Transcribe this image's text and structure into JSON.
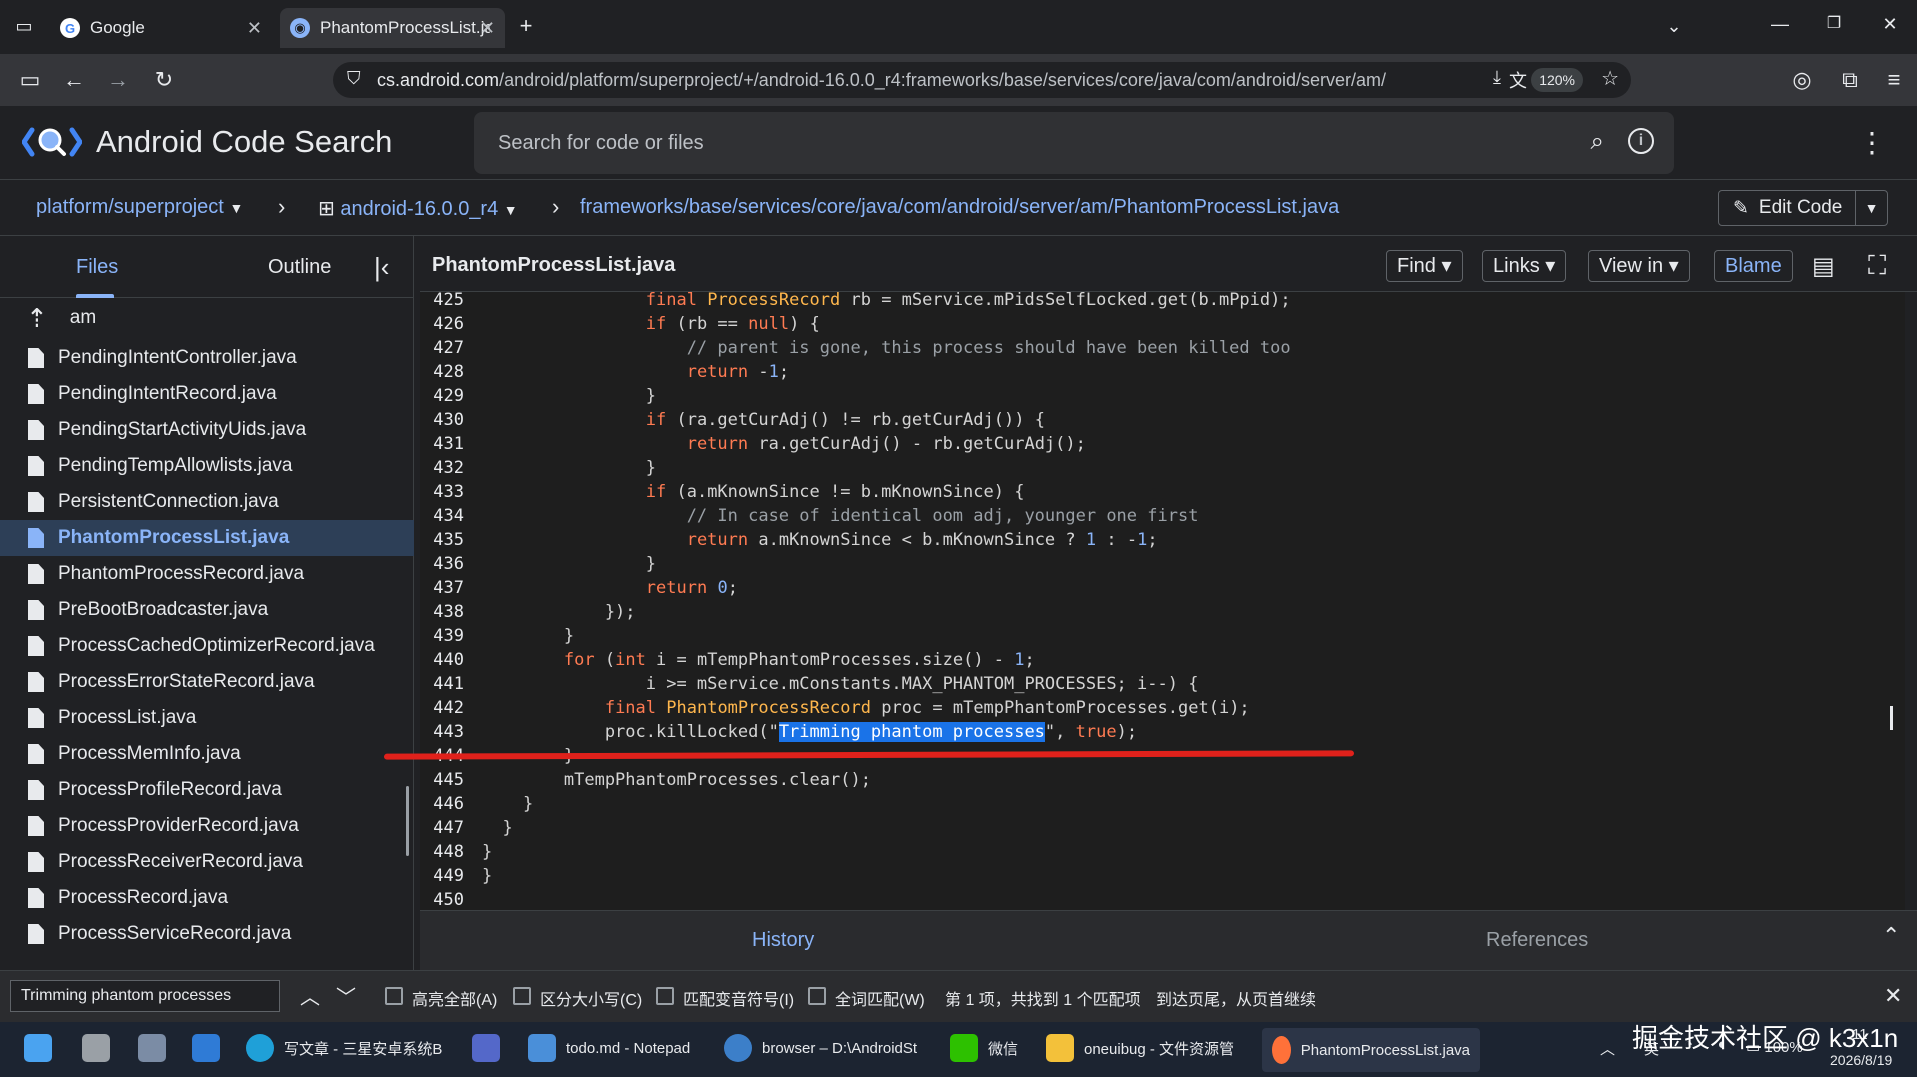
{
  "browser": {
    "tabs": [
      {
        "title": "Google"
      },
      {
        "title": "PhantomProcessList.java - Ar"
      }
    ],
    "url_host": "cs.android.com",
    "url_path": "/android/platform/superproject/+/android-16.0.0_r4:frameworks/base/services/core/java/com/android/server/am/",
    "zoom": "120%"
  },
  "app": {
    "title": "Android Code Search",
    "search_placeholder": "Search for code or files"
  },
  "breadcrumb": {
    "project": "platform/superproject",
    "branch": "android-16.0.0_r4",
    "path": "frameworks/base/services/core/java/com/android/server/am/PhantomProcessList.java",
    "edit_label": "Edit Code"
  },
  "sidebar": {
    "tab_files": "Files",
    "tab_outline": "Outline",
    "parent_dir": "am",
    "files": [
      "PendingIntentController.java",
      "PendingIntentRecord.java",
      "PendingStartActivityUids.java",
      "PendingTempAllowlists.java",
      "PersistentConnection.java",
      "PhantomProcessList.java",
      "PhantomProcessRecord.java",
      "PreBootBroadcaster.java",
      "ProcessCachedOptimizerRecord.java",
      "ProcessErrorStateRecord.java",
      "ProcessList.java",
      "ProcessMemInfo.java",
      "ProcessProfileRecord.java",
      "ProcessProviderRecord.java",
      "ProcessReceiverRecord.java",
      "ProcessRecord.java",
      "ProcessServiceRecord.java"
    ],
    "active_file": "PhantomProcessList.java"
  },
  "code": {
    "filename": "PhantomProcessList.java",
    "toolbar": {
      "find": "Find",
      "links": "Links",
      "view_in": "View in",
      "blame": "Blame"
    },
    "highlight": "Trimming phantom processes",
    "lines": [
      {
        "n": "425",
        "text": "                final ProcessRecord rb = mService.mPidsSelfLocked.get(b.mPpid);"
      },
      {
        "n": "426",
        "text": "                if (rb == null) {"
      },
      {
        "n": "427",
        "text": "                    // parent is gone, this process should have been killed too"
      },
      {
        "n": "428",
        "text": "                    return -1;"
      },
      {
        "n": "429",
        "text": "                }"
      },
      {
        "n": "430",
        "text": "                if (ra.getCurAdj() != rb.getCurAdj()) {"
      },
      {
        "n": "431",
        "text": "                    return ra.getCurAdj() - rb.getCurAdj();"
      },
      {
        "n": "432",
        "text": "                }"
      },
      {
        "n": "433",
        "text": "                if (a.mKnownSince != b.mKnownSince) {"
      },
      {
        "n": "434",
        "text": "                    // In case of identical oom adj, younger one first"
      },
      {
        "n": "435",
        "text": "                    return a.mKnownSince < b.mKnownSince ? 1 : -1;"
      },
      {
        "n": "436",
        "text": "                }"
      },
      {
        "n": "437",
        "text": "                return 0;"
      },
      {
        "n": "438",
        "text": "            });"
      },
      {
        "n": "439",
        "text": "        }"
      },
      {
        "n": "440",
        "text": "        for (int i = mTempPhantomProcesses.size() - 1;"
      },
      {
        "n": "441",
        "text": "                i >= mService.mConstants.MAX_PHANTOM_PROCESSES; i--) {"
      },
      {
        "n": "442",
        "text": "            final PhantomProcessRecord proc = mTempPhantomProcesses.get(i);"
      },
      {
        "n": "443",
        "text": "            proc.killLocked(\"Trimming phantom processes\", true);"
      },
      {
        "n": "444",
        "text": "        }"
      },
      {
        "n": "445",
        "text": "        mTempPhantomProcesses.clear();"
      },
      {
        "n": "446",
        "text": "    }"
      },
      {
        "n": "447",
        "text": "  }"
      },
      {
        "n": "448",
        "text": "}"
      },
      {
        "n": "449",
        "text": "}"
      },
      {
        "n": "450",
        "text": ""
      }
    ],
    "bottom_tabs": {
      "history": "History",
      "references": "References"
    }
  },
  "findbar": {
    "query": "Trimming phantom processes",
    "opt_highlight_all": "高亮全部(A)",
    "opt_match_case": "区分大小写(C)",
    "opt_diacritics": "匹配变音符号(I)",
    "opt_whole_words": "全词匹配(W)",
    "result": "第 1 项，共找到 1 个匹配项",
    "wrap_notice": "到达页尾，从页首继续"
  },
  "taskbar": {
    "items": [
      {
        "label": "写文章 - 三星安卓系统B"
      },
      {
        "label": "todo.md - Notepad"
      },
      {
        "label": "browser – D:\\AndroidSt"
      },
      {
        "label": "微信"
      },
      {
        "label": "oneuibug - 文件资源管"
      },
      {
        "label": "PhantomProcessList.java"
      }
    ],
    "lang": "英",
    "battery": "100%",
    "time": "11",
    "date": "2026/8/19"
  },
  "watermark": "掘金技术社区 @ k3x1n",
  "colors": {
    "accent": "#8ab4f8",
    "highlight": "#1a73e8",
    "annotation": "#e0211b"
  }
}
